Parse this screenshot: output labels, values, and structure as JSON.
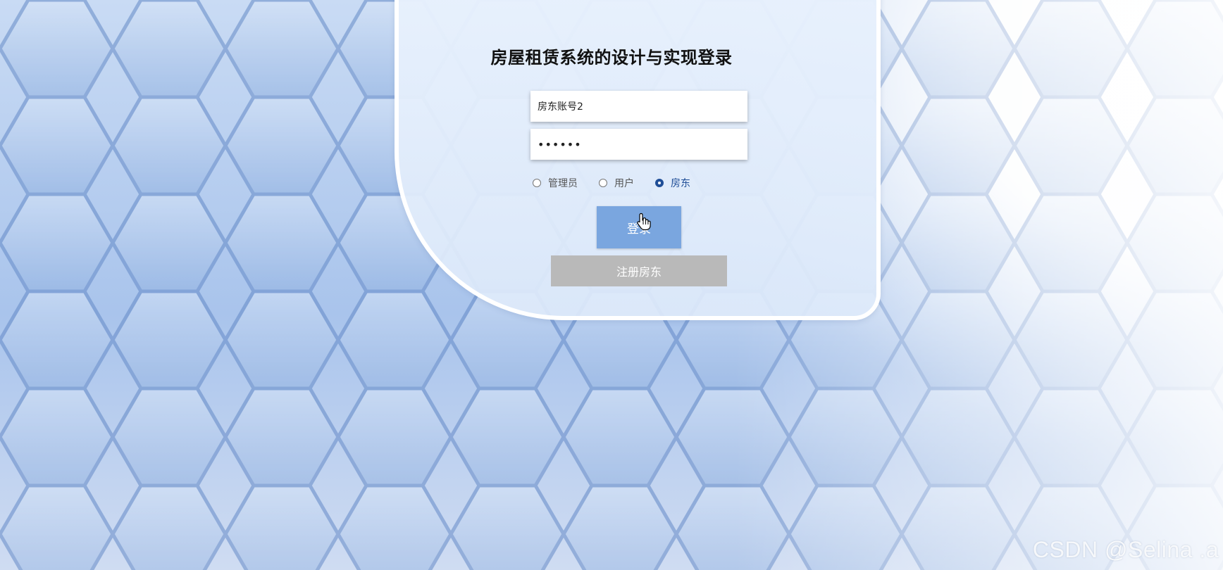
{
  "page": {
    "title": "房屋租赁系统的设计与实现登录"
  },
  "form": {
    "username_value": "房东账号2",
    "password_value": "••••••",
    "roles": [
      {
        "label": "管理员",
        "selected": false
      },
      {
        "label": "用户",
        "selected": false
      },
      {
        "label": "房东",
        "selected": true
      }
    ],
    "login_label": "登录",
    "register_label": "注册房东"
  },
  "watermark": "CSDN @Selina .a",
  "colors": {
    "login_button": "#7aa6df",
    "register_button": "#b9b9b9",
    "selected_radio": "#1f4e97",
    "card_background": "#e6effc"
  },
  "icons": {
    "cursor": "hand-pointer-icon"
  }
}
